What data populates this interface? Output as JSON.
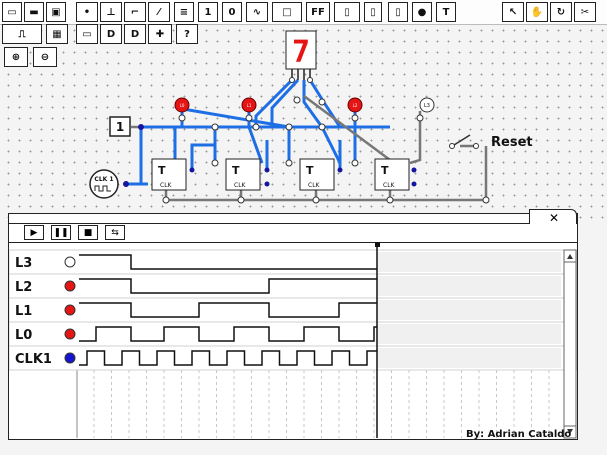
{
  "app": {
    "credit": "By: Adrian Cataldo"
  },
  "toolbar": {
    "row1": [
      {
        "name": "new-file-icon",
        "glyph": "▭"
      },
      {
        "name": "open-folder-icon",
        "glyph": "▬"
      },
      {
        "name": "save-icon",
        "glyph": "▣"
      },
      {
        "name": "point-tool-icon",
        "glyph": "•"
      },
      {
        "name": "pushbutton-tool-icon",
        "glyph": "⊥"
      },
      {
        "name": "switch-tool-icon",
        "glyph": "⌐"
      },
      {
        "name": "switch-open-tool-icon",
        "glyph": "⁄"
      },
      {
        "name": "battery-tool-icon",
        "glyph": "≡"
      },
      {
        "name": "input-1-tool",
        "glyph": "1"
      },
      {
        "name": "input-0-tool",
        "glyph": "0"
      },
      {
        "name": "clock-source-tool",
        "glyph": "∿"
      },
      {
        "name": "resistor-tool-icon",
        "glyph": "□"
      },
      {
        "name": "flipflop-tool",
        "glyph": "FF"
      },
      {
        "name": "led-bar-tool-icon",
        "glyph": "▯"
      },
      {
        "name": "display-tool-icon",
        "glyph": "▯"
      },
      {
        "name": "chip-tool-icon",
        "glyph": "▯"
      },
      {
        "name": "led-tool-icon",
        "glyph": "●"
      },
      {
        "name": "text-tool",
        "glyph": "T"
      }
    ],
    "row1_right": [
      {
        "name": "pointer-icon",
        "glyph": "↖"
      },
      {
        "name": "hand-pan-icon",
        "glyph": "✋"
      },
      {
        "name": "rotate-icon",
        "glyph": "↻"
      },
      {
        "name": "cut-icon",
        "glyph": "✂"
      }
    ],
    "row2": [
      {
        "name": "clock-wave-icon",
        "glyph": "⎍"
      },
      {
        "name": "gate-array-icon",
        "glyph": "▦"
      },
      {
        "name": "chip-icon",
        "glyph": "▭"
      },
      {
        "name": "and-gate-icon",
        "glyph": "D"
      },
      {
        "name": "or-gate-icon",
        "glyph": "D"
      },
      {
        "name": "plus-icon",
        "glyph": "✚"
      },
      {
        "name": "help-icon",
        "glyph": "?"
      }
    ],
    "row3": [
      {
        "name": "zoom-in-icon",
        "glyph": "⊕"
      },
      {
        "name": "zoom-out-icon",
        "glyph": "⊖"
      }
    ]
  },
  "schematic": {
    "input_label": "1",
    "clock_label": "CLK 1",
    "flipflop_label": "T",
    "flipflop_clk": "CLK",
    "led_labels": [
      "L3",
      "L2",
      "L1",
      "L0"
    ],
    "output_led_label": "L3",
    "switch_label": "Reset",
    "display_digit": "7"
  },
  "waveform": {
    "controls": [
      {
        "name": "play-button",
        "glyph": "▶"
      },
      {
        "name": "pause-button",
        "glyph": "❚❚"
      },
      {
        "name": "stop-button",
        "glyph": "■"
      },
      {
        "name": "swap-button",
        "glyph": "⇆"
      }
    ],
    "signals": [
      {
        "name": "L3",
        "color": "#ffffff",
        "transitions": [
          [
            0,
            1
          ],
          [
            52,
            0
          ]
        ]
      },
      {
        "name": "L2",
        "color": "#e51515",
        "transitions": [
          [
            0,
            1
          ],
          [
            52,
            0
          ],
          [
            190,
            1
          ],
          [
            260,
            1
          ]
        ]
      },
      {
        "name": "L1",
        "color": "#e51515",
        "transitions": [
          [
            0,
            1
          ],
          [
            52,
            0
          ],
          [
            120,
            1
          ],
          [
            190,
            0
          ],
          [
            260,
            1
          ]
        ]
      },
      {
        "name": "L0",
        "color": "#e51515",
        "transitions": [
          [
            0,
            0
          ],
          [
            17,
            1
          ],
          [
            52,
            0
          ],
          [
            85,
            1
          ],
          [
            120,
            0
          ],
          [
            155,
            1
          ],
          [
            190,
            0
          ],
          [
            225,
            1
          ],
          [
            260,
            0
          ],
          [
            295,
            1
          ]
        ]
      },
      {
        "name": "CLK1",
        "color": "#1515d0",
        "transitions": []
      }
    ]
  }
}
